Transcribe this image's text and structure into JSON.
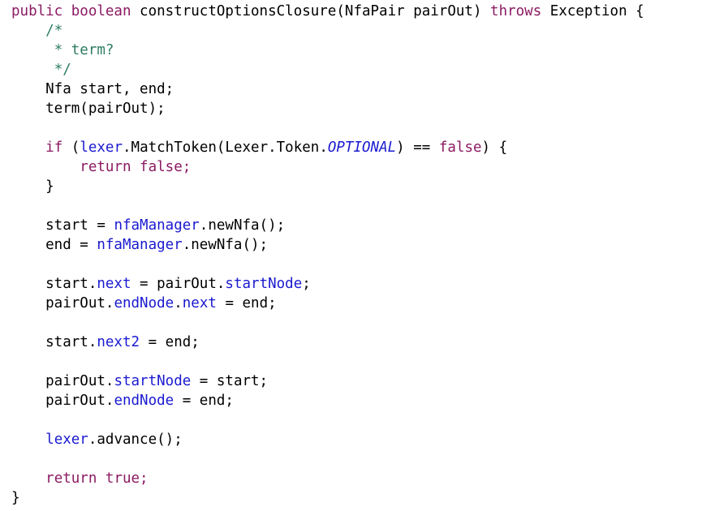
{
  "editor": {
    "name": "java-source-view",
    "language": "Java",
    "background_color": "#ffffff",
    "colors": {
      "plain": "#000000",
      "keyword": "#8b1a62",
      "comment": "#2e7d63",
      "field": "#1a1ad0",
      "constant": "#1a1ad0"
    },
    "lines": [
      {
        "index": 1,
        "text": "public boolean constructOptionsClosure(NfaPair pairOut) throws Exception {",
        "tokens": [
          {
            "text": "public boolean",
            "style": "keyword"
          },
          {
            "text": " constructOptionsClosure(NfaPair pairOut) ",
            "style": "plain"
          },
          {
            "text": "throws",
            "style": "keyword"
          },
          {
            "text": " Exception {",
            "style": "plain"
          }
        ]
      },
      {
        "index": 2,
        "text": "    /*",
        "tokens": [
          {
            "text": "    ",
            "style": "plain"
          },
          {
            "text": "/*",
            "style": "comment"
          }
        ]
      },
      {
        "index": 3,
        "text": "     * term?",
        "tokens": [
          {
            "text": "     ",
            "style": "plain"
          },
          {
            "text": "* term?",
            "style": "comment"
          }
        ]
      },
      {
        "index": 4,
        "text": "     */",
        "tokens": [
          {
            "text": "     ",
            "style": "plain"
          },
          {
            "text": "*/",
            "style": "comment"
          }
        ]
      },
      {
        "index": 5,
        "text": "    Nfa start, end;",
        "tokens": [
          {
            "text": "    Nfa start, end;",
            "style": "plain"
          }
        ]
      },
      {
        "index": 6,
        "text": "    term(pairOut);",
        "tokens": [
          {
            "text": "    term(pairOut);",
            "style": "plain"
          }
        ]
      },
      {
        "index": 7,
        "text": "",
        "tokens": []
      },
      {
        "index": 8,
        "text": "    if (lexer.MatchToken(Lexer.Token.OPTIONAL) == false) {",
        "tokens": [
          {
            "text": "    ",
            "style": "plain"
          },
          {
            "text": "if",
            "style": "keyword"
          },
          {
            "text": " (",
            "style": "plain"
          },
          {
            "text": "lexer",
            "style": "field"
          },
          {
            "text": ".MatchToken(Lexer.Token.",
            "style": "plain"
          },
          {
            "text": "OPTIONAL",
            "style": "constant"
          },
          {
            "text": ") == ",
            "style": "plain"
          },
          {
            "text": "false",
            "style": "keyword"
          },
          {
            "text": ") {",
            "style": "plain"
          }
        ]
      },
      {
        "index": 9,
        "text": "        return false;",
        "tokens": [
          {
            "text": "        ",
            "style": "plain"
          },
          {
            "text": "return false;",
            "style": "keyword"
          }
        ]
      },
      {
        "index": 10,
        "text": "    }",
        "tokens": [
          {
            "text": "    }",
            "style": "plain"
          }
        ]
      },
      {
        "index": 11,
        "text": "",
        "tokens": []
      },
      {
        "index": 12,
        "text": "    start = nfaManager.newNfa();",
        "tokens": [
          {
            "text": "    start = ",
            "style": "plain"
          },
          {
            "text": "nfaManager",
            "style": "field"
          },
          {
            "text": ".newNfa();",
            "style": "plain"
          }
        ]
      },
      {
        "index": 13,
        "text": "    end = nfaManager.newNfa();",
        "tokens": [
          {
            "text": "    end = ",
            "style": "plain"
          },
          {
            "text": "nfaManager",
            "style": "field"
          },
          {
            "text": ".newNfa();",
            "style": "plain"
          }
        ]
      },
      {
        "index": 14,
        "text": "",
        "tokens": []
      },
      {
        "index": 15,
        "text": "    start.next = pairOut.startNode;",
        "tokens": [
          {
            "text": "    start.",
            "style": "plain"
          },
          {
            "text": "next",
            "style": "field"
          },
          {
            "text": " = pairOut.",
            "style": "plain"
          },
          {
            "text": "startNode",
            "style": "field"
          },
          {
            "text": ";",
            "style": "plain"
          }
        ]
      },
      {
        "index": 16,
        "text": "    pairOut.endNode.next = end;",
        "tokens": [
          {
            "text": "    pairOut.",
            "style": "plain"
          },
          {
            "text": "endNode",
            "style": "field"
          },
          {
            "text": ".",
            "style": "plain"
          },
          {
            "text": "next",
            "style": "field"
          },
          {
            "text": " = end;",
            "style": "plain"
          }
        ]
      },
      {
        "index": 17,
        "text": "",
        "tokens": []
      },
      {
        "index": 18,
        "text": "    start.next2 = end;",
        "tokens": [
          {
            "text": "    start.",
            "style": "plain"
          },
          {
            "text": "next2",
            "style": "field"
          },
          {
            "text": " = end;",
            "style": "plain"
          }
        ]
      },
      {
        "index": 19,
        "text": "",
        "tokens": []
      },
      {
        "index": 20,
        "text": "    pairOut.startNode = start;",
        "tokens": [
          {
            "text": "    pairOut.",
            "style": "plain"
          },
          {
            "text": "startNode",
            "style": "field"
          },
          {
            "text": " = start;",
            "style": "plain"
          }
        ]
      },
      {
        "index": 21,
        "text": "    pairOut.endNode = end;",
        "tokens": [
          {
            "text": "    pairOut.",
            "style": "plain"
          },
          {
            "text": "endNode",
            "style": "field"
          },
          {
            "text": " = end;",
            "style": "plain"
          }
        ]
      },
      {
        "index": 22,
        "text": "",
        "tokens": []
      },
      {
        "index": 23,
        "text": "    lexer.advance();",
        "tokens": [
          {
            "text": "    ",
            "style": "plain"
          },
          {
            "text": "lexer",
            "style": "field"
          },
          {
            "text": ".advance();",
            "style": "plain"
          }
        ]
      },
      {
        "index": 24,
        "text": "",
        "tokens": []
      },
      {
        "index": 25,
        "text": "    return true;",
        "tokens": [
          {
            "text": "    ",
            "style": "plain"
          },
          {
            "text": "return true;",
            "style": "keyword"
          }
        ]
      },
      {
        "index": 26,
        "text": "}",
        "tokens": [
          {
            "text": "}",
            "style": "plain"
          }
        ]
      }
    ]
  }
}
